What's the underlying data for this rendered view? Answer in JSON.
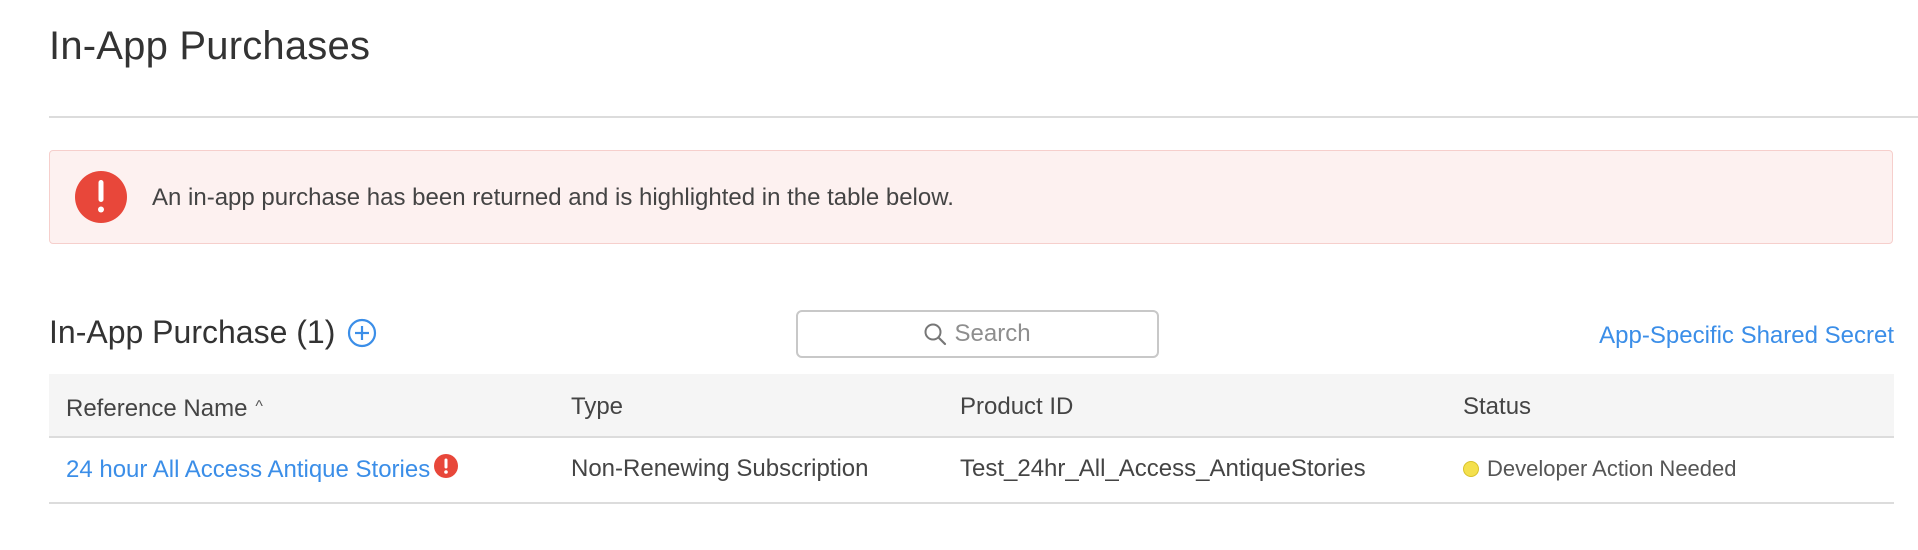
{
  "page": {
    "title": "In-App Purchases"
  },
  "alert": {
    "icon": "error-exclamation-icon",
    "message": "An in-app purchase has been returned and is highlighted in the table below.",
    "color": "#e8473a"
  },
  "section": {
    "title": "In-App Purchase (1)",
    "add_icon": "add-circle-icon"
  },
  "search": {
    "placeholder": "Search",
    "value": ""
  },
  "shared_secret_link": "App-Specific Shared Secret",
  "table": {
    "columns": [
      "Reference Name",
      "Type",
      "Product ID",
      "Status"
    ],
    "sort_indicator": "^",
    "rows": [
      {
        "reference_name": "24 hour All Access Antique Stories",
        "warning_icon": "error-exclamation-icon",
        "type": "Non-Renewing Subscription",
        "product_id": "Test_24hr_All_Access_AntiqueStories",
        "status": "Developer Action Needed",
        "status_color": "#f4e04d"
      }
    ]
  },
  "colors": {
    "accent": "#3b8ee8",
    "error": "#e8473a",
    "alert_background": "#fdf1f0",
    "status_warning": "#f4e04d"
  }
}
